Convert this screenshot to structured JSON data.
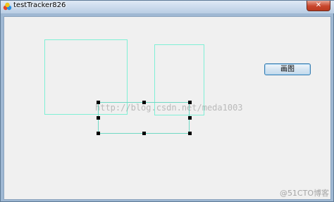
{
  "window": {
    "title": "testTracker826",
    "close_glyph": "✕"
  },
  "toolbar": {
    "draw_label": "画图"
  },
  "watermark": {
    "text": "http://blog.csdn.net/meda1003"
  },
  "corner_mark": {
    "text": "@51CTO博客"
  },
  "colors": {
    "rect_border": "#7ff0d6",
    "handle": "#000000",
    "button_border": "#3c7fb1"
  }
}
